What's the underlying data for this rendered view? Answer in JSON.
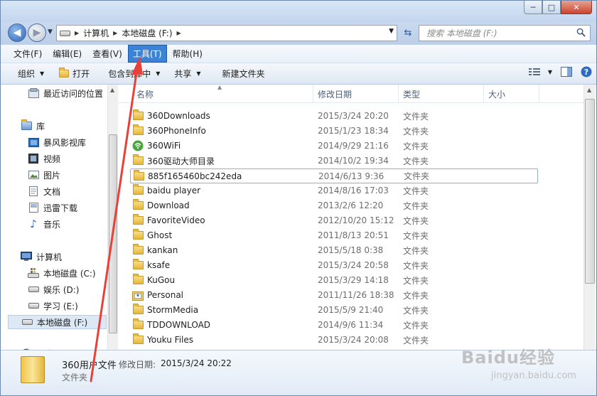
{
  "window": {
    "minimize": "─",
    "maximize": "□",
    "close": "✕"
  },
  "address": {
    "segments": [
      "计算机",
      "本地磁盘 (F:)"
    ]
  },
  "search": {
    "placeholder": "搜索 本地磁盘 (F:)"
  },
  "menu": [
    {
      "label": "文件(F)"
    },
    {
      "label": "编辑(E)"
    },
    {
      "label": "查看(V)"
    },
    {
      "label": "工具(T)"
    },
    {
      "label": "帮助(H)"
    }
  ],
  "toolbar": {
    "organize": "组织",
    "open": "打开",
    "include_library": "包含到库中",
    "share": "共享",
    "new_folder": "新建文件夹"
  },
  "nav": {
    "recent": "最近访问的位置",
    "libraries": "库",
    "storm": "暴风影视库",
    "videos": "视频",
    "pictures": "图片",
    "documents": "文档",
    "xunlei": "迅雷下载",
    "music": "音乐",
    "computer": "计算机",
    "drive_c": "本地磁盘 (C:)",
    "drive_d": "娱乐 (D:)",
    "drive_e": "学习 (E:)",
    "drive_f": "本地磁盘 (F:)",
    "network_partial": "网络"
  },
  "columns": {
    "name": "名称",
    "date": "修改日期",
    "type": "类型",
    "size": "大小"
  },
  "files": [
    {
      "name": "360Downloads",
      "date": "2015/3/24 20:20",
      "type": "文件夹",
      "icon": "folder"
    },
    {
      "name": "360PhoneInfo",
      "date": "2015/1/23 18:34",
      "type": "文件夹",
      "icon": "folder"
    },
    {
      "name": "360WiFi",
      "date": "2014/9/29 21:16",
      "type": "文件夹",
      "icon": "wifi"
    },
    {
      "name": "360驱动大师目录",
      "date": "2014/10/2 19:34",
      "type": "文件夹",
      "icon": "folder"
    },
    {
      "name": "885f165460bc242eda",
      "date": "2014/6/13 9:36",
      "type": "文件夹",
      "icon": "folder"
    },
    {
      "name": "baidu player",
      "date": "2014/8/16 17:03",
      "type": "文件夹",
      "icon": "folder"
    },
    {
      "name": "Download",
      "date": "2013/2/6 12:20",
      "type": "文件夹",
      "icon": "folder"
    },
    {
      "name": "FavoriteVideo",
      "date": "2012/10/20 15:12",
      "type": "文件夹",
      "icon": "folder"
    },
    {
      "name": "Ghost",
      "date": "2011/8/13 20:51",
      "type": "文件夹",
      "icon": "folder"
    },
    {
      "name": "kankan",
      "date": "2015/5/18 0:38",
      "type": "文件夹",
      "icon": "folder"
    },
    {
      "name": "ksafe",
      "date": "2015/3/24 20:58",
      "type": "文件夹",
      "icon": "folder"
    },
    {
      "name": "KuGou",
      "date": "2015/3/29 14:18",
      "type": "文件夹",
      "icon": "folder"
    },
    {
      "name": "Personal",
      "date": "2011/11/26 18:38",
      "type": "文件夹",
      "icon": "personal"
    },
    {
      "name": "StormMedia",
      "date": "2015/5/9 21:40",
      "type": "文件夹",
      "icon": "folder"
    },
    {
      "name": "TDDOWNLOAD",
      "date": "2014/9/6 11:34",
      "type": "文件夹",
      "icon": "folder"
    },
    {
      "name": "Youku Files",
      "date": "2015/3/24 20:08",
      "type": "文件夹",
      "icon": "folder"
    }
  ],
  "details": {
    "name": "360用户文件",
    "date_label": "修改日期:",
    "date": "2015/3/24 20:22",
    "type": "文件夹"
  },
  "watermark": {
    "brand": "Baidu经验",
    "url": "jingyan.baidu.com"
  },
  "colors": {
    "menu_highlight": "#3c83d6",
    "annotation_arrow": "#e8413a"
  }
}
